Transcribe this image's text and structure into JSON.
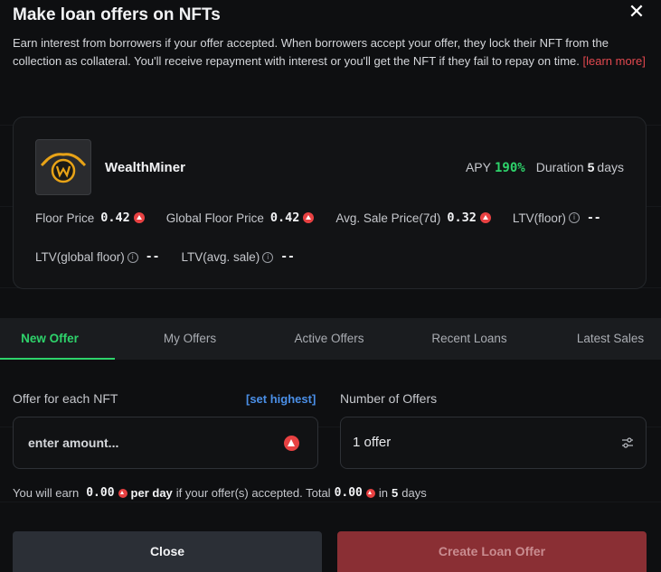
{
  "modal": {
    "title": "Make loan offers on NFTs",
    "description": "Earn interest from borrowers if your offer accepted. When borrowers accept your offer, they lock their NFT from the collection as collateral. You'll receive repayment with interest or you'll get the NFT if they fail to repay on time. ",
    "learn_more": "[learn more]"
  },
  "collection": {
    "name": "WealthMiner",
    "apy_label": "APY",
    "apy_value": "190%",
    "duration_label": "Duration",
    "duration_value": "5",
    "duration_unit": "days",
    "stats_row1": [
      {
        "label": "Floor Price",
        "value": "0.42"
      },
      {
        "label": "Global Floor Price",
        "value": "0.42"
      },
      {
        "label": "Avg. Sale Price(7d)",
        "value": "0.32"
      }
    ],
    "ltv_floor": {
      "label": "LTV(floor)",
      "value": "--"
    },
    "ltv_global": {
      "label": "LTV(global floor)",
      "value": "--"
    },
    "ltv_avg": {
      "label": "LTV(avg. sale)",
      "value": "--"
    }
  },
  "tabs": [
    {
      "label": "New Offer",
      "active": true
    },
    {
      "label": "My Offers",
      "active": false
    },
    {
      "label": "Active Offers",
      "active": false
    },
    {
      "label": "Recent Loans",
      "active": false
    },
    {
      "label": "Latest Sales",
      "active": false
    }
  ],
  "form": {
    "offer_label": "Offer for each NFT",
    "set_highest": "[set highest]",
    "amount_placeholder": "enter amount...",
    "count_label": "Number of Offers",
    "count_value": "1 offer"
  },
  "earn": {
    "prefix": "You will earn",
    "per_day_amount": "0.00",
    "per_day": "per day",
    "middle": "if your offer(s) accepted. Total",
    "total_amount": "0.00",
    "in": "in",
    "days_value": "5",
    "days": "days"
  },
  "buttons": {
    "close": "Close",
    "create": "Create Loan Offer"
  },
  "colors": {
    "accent_green": "#2ed36b",
    "avax_red": "#e84142",
    "link_blue": "#4a8fe7",
    "create_button": "#8a2f34"
  }
}
